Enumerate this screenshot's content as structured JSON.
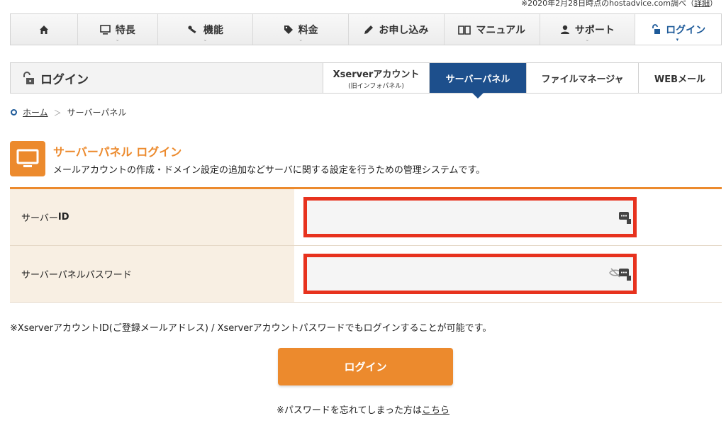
{
  "top_note": {
    "text": "※2020年2月28日時点のhostadvice.com調べ（",
    "link": "詳細",
    "close": "）"
  },
  "global_nav": [
    {
      "name": "home",
      "label": ""
    },
    {
      "name": "features",
      "label": "特長"
    },
    {
      "name": "functions",
      "label": "機能"
    },
    {
      "name": "pricing",
      "label": "料金"
    },
    {
      "name": "apply",
      "label": "お申し込み"
    },
    {
      "name": "manual",
      "label": "マニュアル"
    },
    {
      "name": "support",
      "label": "サポート"
    },
    {
      "name": "login",
      "label": "ログイン"
    }
  ],
  "subbar": {
    "title": "ログイン",
    "tabs": [
      {
        "label": "Xserverアカウント",
        "sub": "(旧インフォパネル)"
      },
      {
        "label": "サーバーパネル",
        "sub": ""
      },
      {
        "label": "ファイルマネージャ",
        "sub": ""
      },
      {
        "label": "WEBメール",
        "sub": ""
      }
    ],
    "active_tab": "サーバーパネル"
  },
  "breadcrumb": {
    "home": "ホーム",
    "separator": "＞",
    "current": "サーバーパネル"
  },
  "heading": {
    "title": "サーバーパネル ログイン",
    "description": "メールアカウントの作成・ドメイン設定の追加などサーバに関する設定を行うための管理システムです。"
  },
  "form": {
    "server_id_label_prefix": "サーバー",
    "server_id_label_bold": "ID",
    "server_id_value": "",
    "password_label": "サーバーパネルパスワード",
    "password_value": ""
  },
  "note": "※XserverアカウントID(ご登録メールアドレス) / Xserverアカウントパスワードでもログインすることが可能です。",
  "login_button": "ログイン",
  "forgot": {
    "text": "※パスワードを忘れてしまった方は",
    "link": "こちら"
  },
  "colors": {
    "accent": "#ec8a2d",
    "brand_blue": "#1d4f8c",
    "highlight": "#e7321e"
  }
}
